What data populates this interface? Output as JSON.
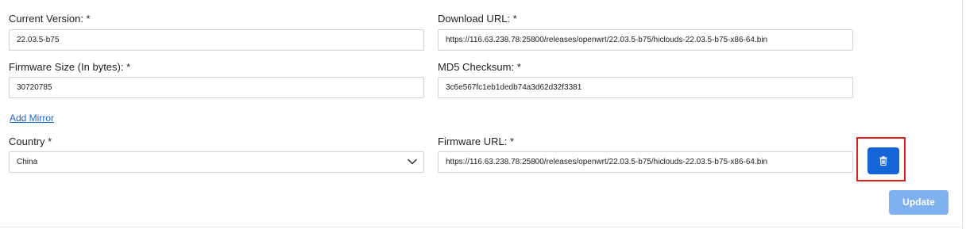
{
  "form": {
    "current_version": {
      "label": "Current Version: *",
      "value": "22.03.5-b75"
    },
    "download_url": {
      "label": "Download URL: *",
      "value": "https://116.63.238.78:25800/releases/openwrt/22.03.5-b75/hiclouds-22.03.5-b75-x86-64.bin"
    },
    "firmware_size": {
      "label": "Firmware Size (In bytes): *",
      "value": "30720785"
    },
    "md5_checksum": {
      "label": "MD5 Checksum: *",
      "value": "3c6e567fc1eb1dedb74a3d62d32f3381"
    },
    "add_mirror_label": "Add Mirror",
    "mirror": {
      "country_label": "Country *",
      "country_value": "China",
      "firmware_url_label": "Firmware URL: *",
      "firmware_url_value": "https://116.63.238.78:25800/releases/openwrt/22.03.5-b75/hiclouds-22.03.5-b75-x86-64.bin",
      "delete_icon": "trash-icon"
    },
    "update_label": "Update"
  },
  "colors": {
    "primary_button": "#1466d8",
    "disabled_button": "#7fb0f0",
    "link": "#1a66c9",
    "highlight": "#e0201f"
  }
}
